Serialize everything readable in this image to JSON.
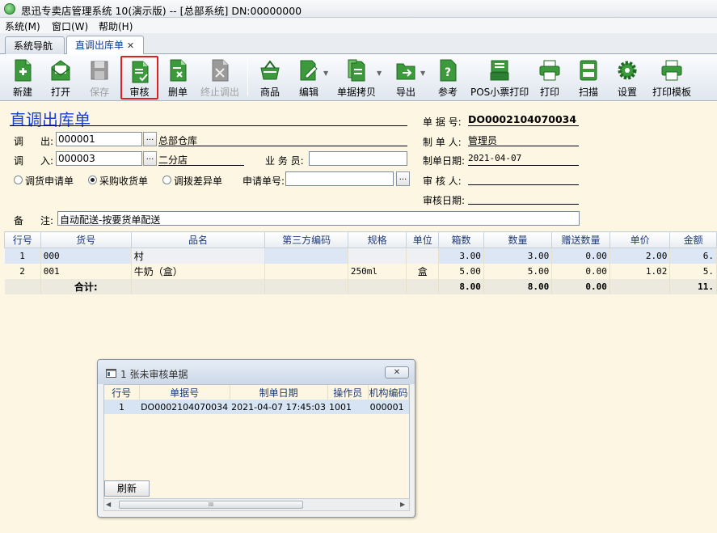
{
  "window": {
    "title": "思迅专卖店管理系统 10(演示版) -- [总部系统] DN:00000000"
  },
  "menu": [
    "系统(M)",
    "窗口(W)",
    "帮助(H)"
  ],
  "tabs": [
    {
      "label": "系统导航"
    },
    {
      "label": "直调出库单",
      "close": "✕"
    }
  ],
  "toolbar": {
    "new": "新建",
    "open": "打开",
    "save": "保存",
    "audit": "审核",
    "delete": "删单",
    "stop": "终止调出",
    "goods": "商品",
    "edit": "编辑",
    "copy": "单据拷贝",
    "export": "导出",
    "reference": "参考",
    "pos_print": "POS小票打印",
    "print": "打印",
    "scan": "扫描",
    "settings": "设置",
    "print_template": "打印模板"
  },
  "form": {
    "title": "直调出库单",
    "out_label_a": "调",
    "out_label_b": "出:",
    "out_code": "000001",
    "out_name": "总部仓库",
    "in_label_a": "调",
    "in_label_b": "入:",
    "in_code": "000003",
    "in_name": "二分店",
    "salesman_label": "业 务 员:",
    "salesman_value": "",
    "radio_request": "调货申请单",
    "radio_purchase": "采购收货单",
    "radio_diff": "调拨差异单",
    "request_no_label": "申请单号:",
    "request_no_value": "",
    "remark_label_a": "备",
    "remark_label_b": "注:",
    "remark_value": "自动配送-按要货单配送",
    "doc_no_label": "单 据 号:",
    "doc_no": "DO0002104070034",
    "maker_label": "制 单 人:",
    "maker": "管理员",
    "make_date_label": "制单日期:",
    "make_date": "2021-04-07",
    "auditor_label": "审 核 人:",
    "auditor": "",
    "audit_date_label": "审核日期:",
    "audit_date": "",
    "browse": "..."
  },
  "grid": {
    "headers": [
      "行号",
      "货号",
      "品名",
      "第三方编码",
      "规格",
      "单位",
      "箱数",
      "数量",
      "赠送数量",
      "单价",
      "金额"
    ],
    "rows": [
      [
        "1",
        "000",
        "村",
        "",
        "",
        "",
        "3.00",
        "3.00",
        "0.00",
        "2.00",
        "6."
      ],
      [
        "2",
        "001",
        "牛奶（盒）",
        "",
        "250ml",
        "盒",
        "5.00",
        "5.00",
        "0.00",
        "1.02",
        "5."
      ]
    ],
    "total": {
      "label": "合计:",
      "boxes": "8.00",
      "qty": "8.00",
      "gift": "0.00",
      "amount": "11."
    }
  },
  "popup": {
    "title": "1 张未审核单据",
    "headers": [
      "行号",
      "单据号",
      "制单日期",
      "操作员",
      "机构编码"
    ],
    "rows": [
      [
        "1",
        "DO0002104070034",
        "2021-04-07 17:45:03",
        "1001",
        "000001"
      ]
    ],
    "refresh": "刷新",
    "scroll_mark": "III",
    "close": "✕"
  },
  "colors": {
    "accent_title": "#1a3fd1",
    "highlight": "#e02020",
    "background": "#fdf6e3"
  }
}
